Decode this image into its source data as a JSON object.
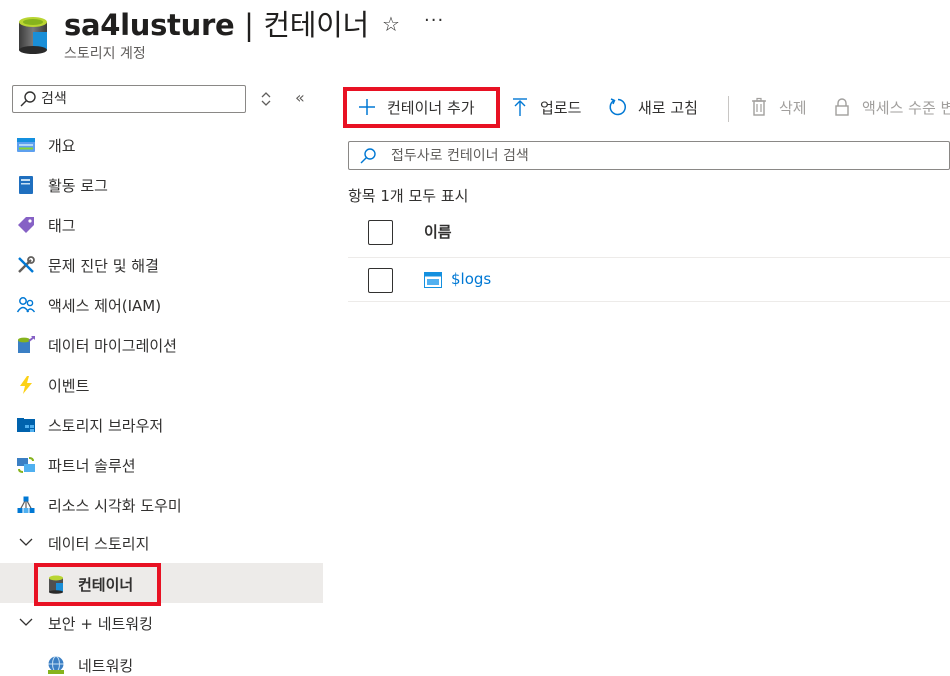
{
  "header": {
    "resource_name": "sa4lusture",
    "separator": "|",
    "section": "컨테이너",
    "subtitle": "스토리지 계정",
    "favorite_icon": "star-icon",
    "more_icon": "ellipsis-icon"
  },
  "sidebar": {
    "search_placeholder": "검색",
    "items": [
      {
        "label": "개요",
        "icon": "overview-icon"
      },
      {
        "label": "활동 로그",
        "icon": "activity-log-icon"
      },
      {
        "label": "태그",
        "icon": "tag-icon"
      },
      {
        "label": "문제 진단 및 해결",
        "icon": "diagnose-icon"
      },
      {
        "label": "액세스 제어(IAM)",
        "icon": "iam-icon"
      },
      {
        "label": "데이터 마이그레이션",
        "icon": "data-migration-icon"
      },
      {
        "label": "이벤트",
        "icon": "lightning-icon"
      },
      {
        "label": "스토리지 브라우저",
        "icon": "storage-browser-icon"
      },
      {
        "label": "파트너 솔루션",
        "icon": "partner-icon"
      },
      {
        "label": "리소스 시각화 도우미",
        "icon": "resource-visualizer-icon"
      }
    ],
    "group_data_storage": "데이터 스토리지",
    "item_containers": "컨테이너",
    "group_security": "보안 + 네트워킹",
    "item_networking": "네트워킹"
  },
  "toolbar": {
    "add_container": "컨테이너 추가",
    "upload": "업로드",
    "refresh": "새로 고침",
    "delete": "삭제",
    "access_level": "액세스 수준 변경"
  },
  "filter": {
    "placeholder": "접두사로 컨테이너 검색"
  },
  "list": {
    "count_text": "항목 1개 모두 표시",
    "column_name": "이름",
    "rows": [
      {
        "name": "$logs"
      }
    ]
  },
  "colors": {
    "accent": "#0078d4",
    "highlight": "#e81123",
    "selected_bg": "#edebe9"
  }
}
